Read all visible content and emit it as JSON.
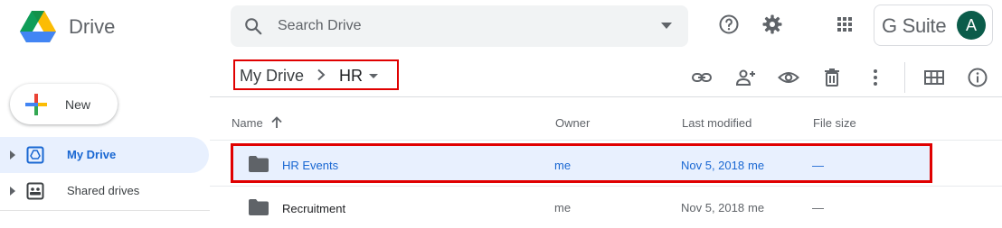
{
  "app": {
    "name": "Drive"
  },
  "search": {
    "placeholder": "Search Drive"
  },
  "account": {
    "suite_label": "G Suite",
    "avatar_initial": "A",
    "avatar_color": "#0b5c4a"
  },
  "new_button": {
    "label": "New"
  },
  "sidebar": {
    "items": [
      {
        "label": "My Drive",
        "icon": "my-drive-icon",
        "active": true
      },
      {
        "label": "Shared drives",
        "icon": "shared-drives-icon",
        "active": false
      }
    ]
  },
  "breadcrumb": {
    "root": "My Drive",
    "current": "HR"
  },
  "toolbar": {
    "icons": [
      "link-icon",
      "add-person-icon",
      "preview-eye-icon",
      "trash-icon",
      "more-vert-icon",
      "grid-view-icon",
      "info-icon"
    ]
  },
  "table": {
    "columns": {
      "name": "Name",
      "owner": "Owner",
      "modified": "Last modified",
      "size": "File size"
    },
    "sort_icon": "arrow-up-icon",
    "rows": [
      {
        "name": "HR Events",
        "owner": "me",
        "modified": "Nov 5, 2018",
        "modified_by": "me",
        "size": "—",
        "selected": true
      },
      {
        "name": "Recruitment",
        "owner": "me",
        "modified": "Nov 5, 2018",
        "modified_by": "me",
        "size": "—",
        "selected": false
      }
    ]
  },
  "colors": {
    "accent": "#1967d2",
    "selection_bg": "#e8f0fe",
    "highlight_border": "#e00000"
  }
}
